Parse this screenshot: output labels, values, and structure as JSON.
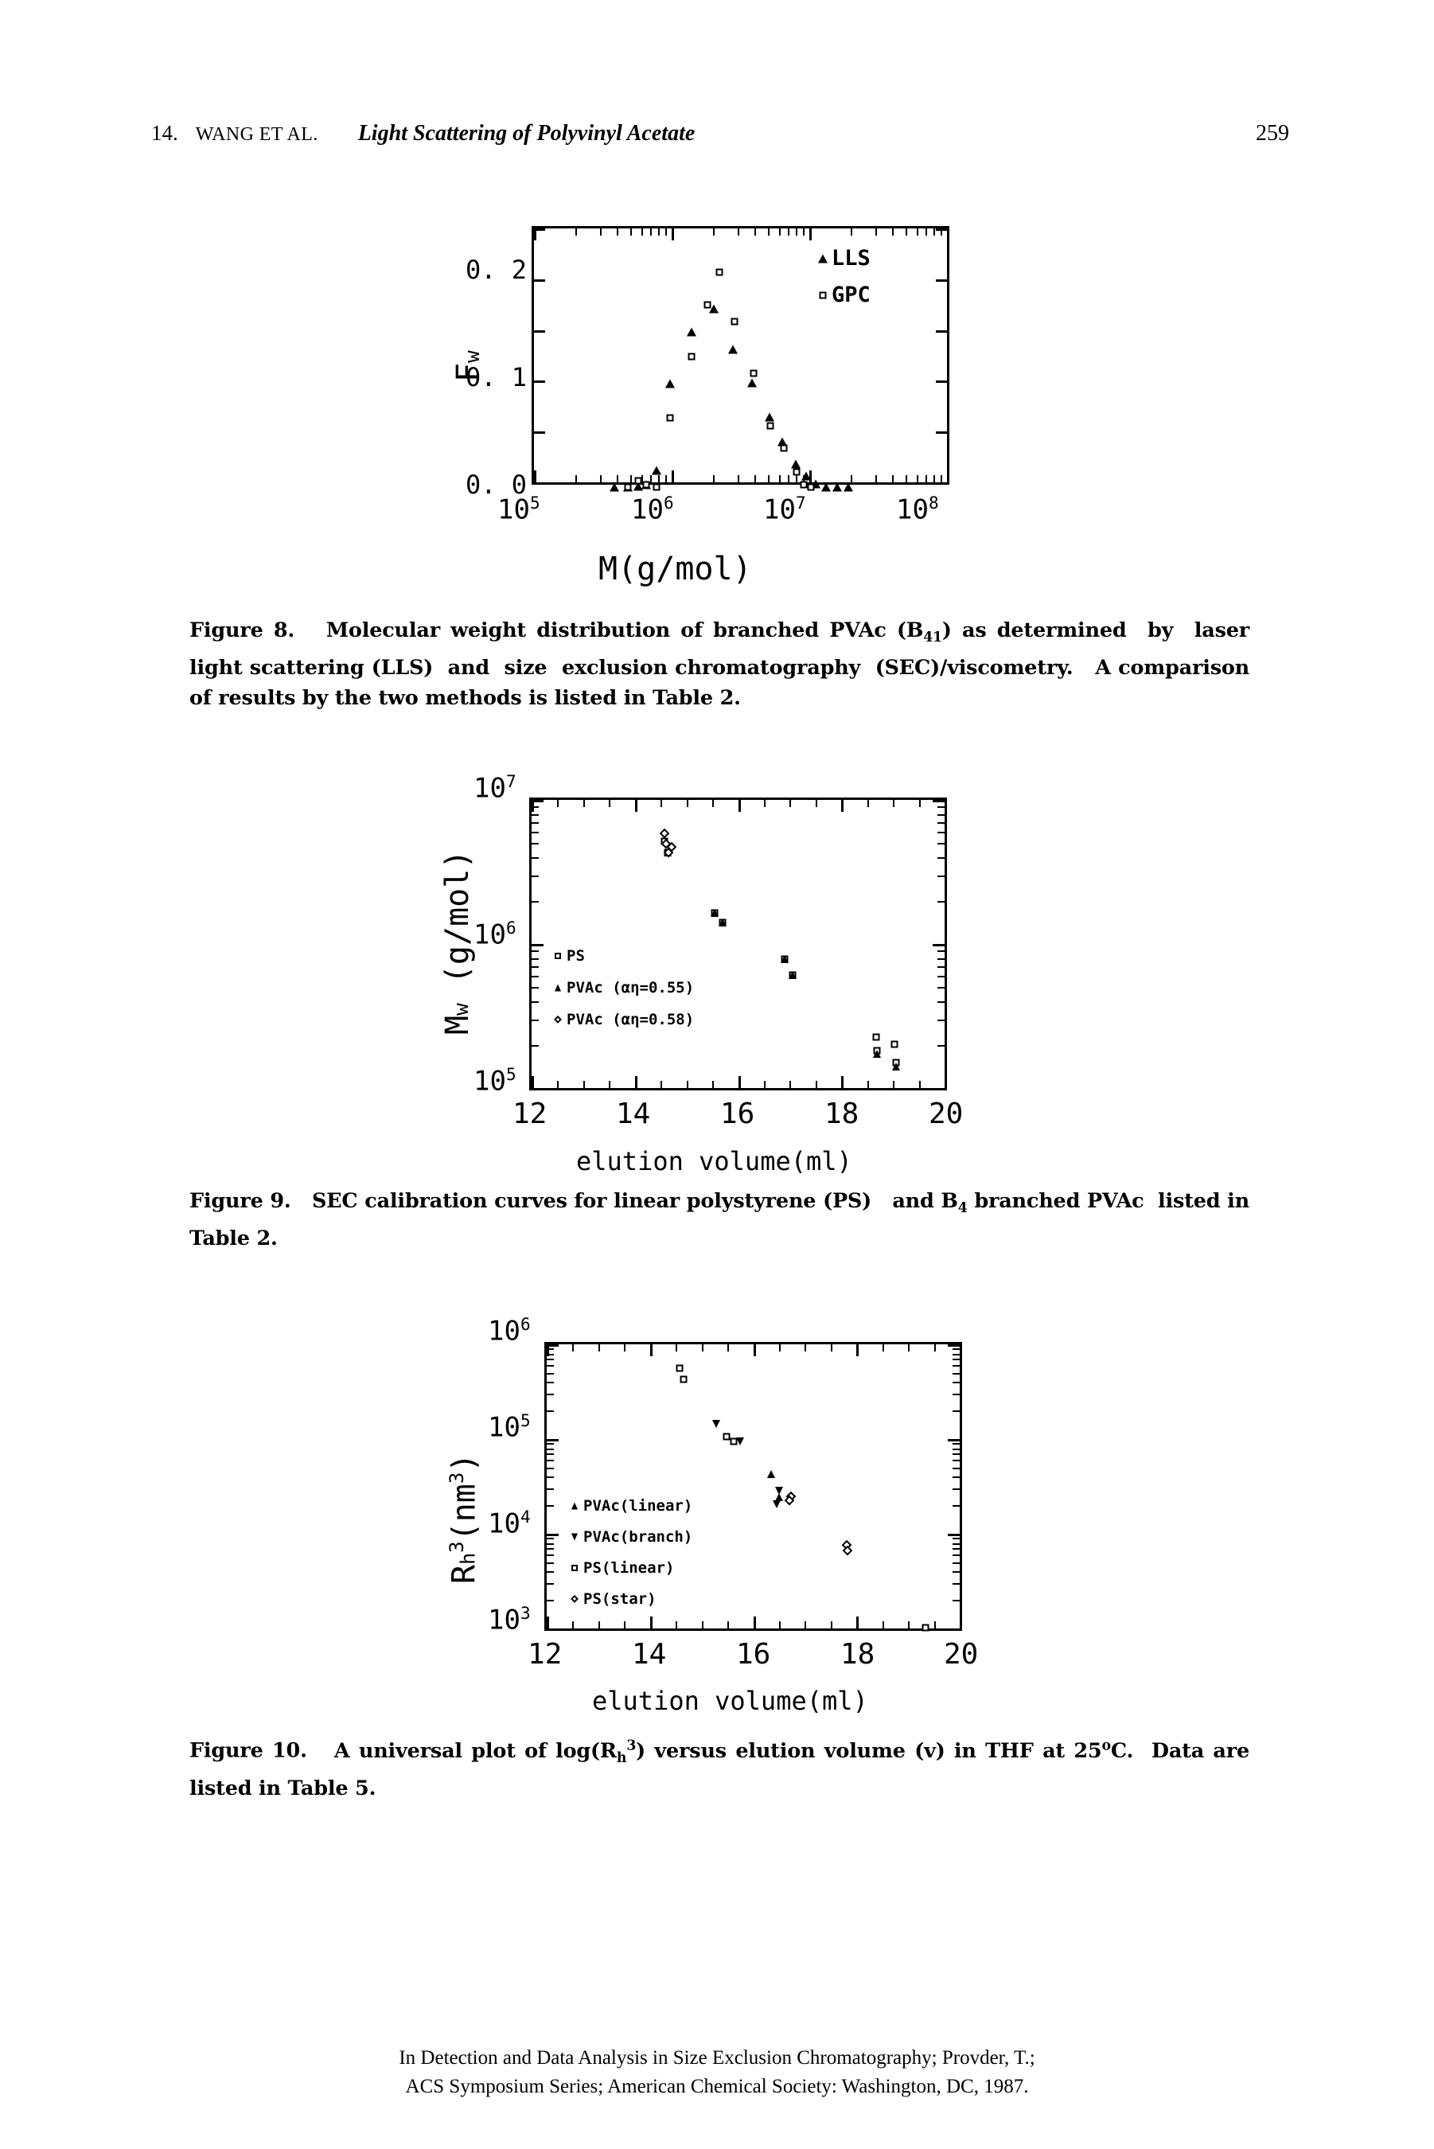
{
  "running_head": {
    "chapter_number": "14.",
    "authors": "WANG ET AL.",
    "title": "Light Scattering of Polyvinyl Acetate",
    "page_number": "259"
  },
  "figures": [
    {
      "id": "figure-8",
      "caption_label": "Figure 8.",
      "caption_text": "Molecular weight distribution of branched PVAc (B41) as determined by laser light scattering (LLS) and size exclusion chromatography (SEC)/viscometry.  A comparison of results by the two methods is listed in Table 2."
    },
    {
      "id": "figure-9",
      "caption_label": "Figure 9.",
      "caption_text": "SEC calibration curves for linear polystyrene (PS)  and B4 branched PVAc  listed in Table 2."
    },
    {
      "id": "figure-10",
      "caption_label": "Figure 10.",
      "caption_text": "A universal plot of log(Rh3) versus elution volume (v) in THF at 25oC.  Data are listed in Table 5."
    }
  ],
  "footer": {
    "line1": "In Detection and Data Analysis in Size Exclusion Chromatography; Provder, T.;",
    "line2": "ACS Symposium Series; American Chemical Society: Washington, DC, 1987."
  },
  "chart_data": [
    {
      "type": "scatter",
      "id": "fig8",
      "title": "",
      "xlabel": "M(g/mol)",
      "ylabel": "Fw",
      "xscale": "log",
      "xlim": [
        100000,
        100000000
      ],
      "ylim": [
        0.0,
        0.25
      ],
      "xticklabels": [
        "10^5",
        "10^6",
        "10^7",
        "10^8"
      ],
      "yticklabels": [
        "0.0",
        "0.1",
        "0.2"
      ],
      "ytickvalues": [
        0.0,
        0.1,
        0.2
      ],
      "grid": false,
      "legend_position": "upper-right",
      "series": [
        {
          "name": "LLS",
          "marker": "triangle",
          "points": [
            [
              380000,
              0.0
            ],
            [
              470000,
              0.0
            ],
            [
              560000,
              0.001
            ],
            [
              640000,
              0.002
            ],
            [
              760000,
              0.016
            ],
            [
              950000,
              0.1
            ],
            [
              1350000,
              0.15
            ],
            [
              1950000,
              0.172
            ],
            [
              2700000,
              0.133
            ],
            [
              3700000,
              0.101
            ],
            [
              4900000,
              0.068
            ],
            [
              6100000,
              0.044
            ],
            [
              7600000,
              0.022
            ],
            [
              9000000,
              0.011
            ],
            [
              10500000,
              0.003
            ],
            [
              12500000,
              0.0
            ],
            [
              15000000,
              0.0
            ],
            [
              18000000,
              0.0
            ]
          ]
        },
        {
          "name": "GPC",
          "marker": "square",
          "points": [
            [
              470000,
              0.0
            ],
            [
              560000,
              0.006
            ],
            [
              640000,
              0.002
            ],
            [
              760000,
              0.0
            ],
            [
              950000,
              0.067
            ],
            [
              1350000,
              0.126
            ],
            [
              1750000,
              0.176
            ],
            [
              2150000,
              0.208
            ],
            [
              2750000,
              0.16
            ],
            [
              3800000,
              0.11
            ],
            [
              5000000,
              0.059
            ],
            [
              6200000,
              0.038
            ],
            [
              7700000,
              0.015
            ],
            [
              8700000,
              0.002
            ],
            [
              9800000,
              0.0
            ]
          ]
        }
      ]
    },
    {
      "type": "scatter",
      "id": "fig9",
      "title": "",
      "xlabel": "elution volume(ml)",
      "ylabel": "Mw (g/mol)",
      "yscale": "log",
      "xlim": [
        12,
        20
      ],
      "ylim": [
        100000,
        10000000
      ],
      "xticklabels": [
        "12",
        "14",
        "16",
        "18",
        "20"
      ],
      "xtickvalues": [
        12,
        14,
        16,
        18,
        20
      ],
      "yticklabels": [
        "10^5",
        "10^6",
        "10^7"
      ],
      "ytickvalues": [
        100000,
        1000000,
        10000000
      ],
      "grid": false,
      "legend_position": "lower-left",
      "legend_entries": [
        "PS",
        "PVAc (αη=0.55)",
        "PVAc (αη=0.58)"
      ],
      "series": [
        {
          "name": "PS",
          "marker": "square",
          "points": [
            [
              14.55,
              5200000
            ],
            [
              14.6,
              4400000
            ],
            [
              15.5,
              1700000
            ],
            [
              15.65,
              1450000
            ],
            [
              16.85,
              820000
            ],
            [
              17.0,
              640000
            ],
            [
              18.6,
              240000
            ],
            [
              18.62,
              195000
            ],
            [
              18.95,
              215000
            ],
            [
              18.98,
              160000
            ]
          ]
        },
        {
          "name": "PVAc (ah=0.55)",
          "marker": "triangle",
          "points": [
            [
              14.6,
              4400000
            ],
            [
              15.5,
              1700000
            ],
            [
              15.65,
              1450000
            ],
            [
              16.85,
              820000
            ],
            [
              17.0,
              640000
            ],
            [
              18.62,
              185000
            ],
            [
              18.98,
              152000
            ]
          ]
        },
        {
          "name": "PVAc (ah=0.58)",
          "marker": "diamond",
          "points": [
            [
              14.55,
              5900000
            ],
            [
              14.57,
              5050000
            ],
            [
              14.68,
              4800000
            ],
            [
              14.62,
              4400000
            ]
          ]
        }
      ]
    },
    {
      "type": "scatter",
      "id": "fig10",
      "title": "",
      "xlabel": "elution volume(ml)",
      "ylabel": "Rh3(nm3)",
      "yscale": "log",
      "xlim": [
        12,
        20
      ],
      "ylim": [
        1000,
        1000000
      ],
      "xticklabels": [
        "12",
        "14",
        "16",
        "18",
        "20"
      ],
      "xtickvalues": [
        12,
        14,
        16,
        18,
        20
      ],
      "yticklabels": [
        "10^3",
        "10^4",
        "10^5",
        "10^6"
      ],
      "ytickvalues": [
        1000,
        10000,
        100000,
        1000000
      ],
      "grid": false,
      "legend_position": "lower-left",
      "legend_entries": [
        "PVAc(linear)",
        "PVAc(branch)",
        "PS(linear)",
        "PS(star)"
      ],
      "series": [
        {
          "name": "PVAc(linear)",
          "marker": "triangle",
          "points": [
            [
              16.3,
              45000
            ],
            [
              16.45,
              26000
            ]
          ]
        },
        {
          "name": "PVAc(branch)",
          "marker": "triangle-down",
          "points": [
            [
              15.25,
              150000
            ],
            [
              15.7,
              98000
            ],
            [
              16.45,
              30000
            ],
            [
              16.4,
              22000
            ]
          ]
        },
        {
          "name": "PS(linear)",
          "marker": "square",
          "points": [
            [
              14.55,
              570000
            ],
            [
              14.62,
              430000
            ],
            [
              15.45,
              110000
            ],
            [
              15.58,
              98000
            ],
            [
              19.25,
              1150
            ]
          ]
        },
        {
          "name": "PS(star)",
          "marker": "diamond",
          "points": [
            [
              16.68,
              26500
            ],
            [
              16.65,
              24000
            ],
            [
              17.75,
              8200
            ],
            [
              17.76,
              7300
            ]
          ]
        }
      ]
    }
  ]
}
